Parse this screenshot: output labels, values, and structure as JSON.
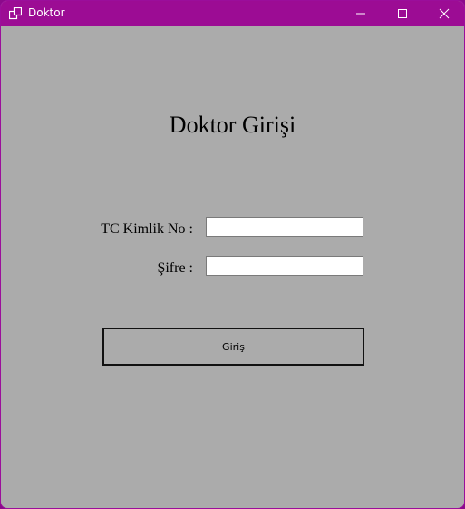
{
  "window": {
    "title": "Doktor",
    "app_icon": "window-icon",
    "controls": [
      "minimize-icon",
      "maximize-icon",
      "close-icon"
    ],
    "accent_color": "#9c0c94",
    "background_color": "#ababab"
  },
  "form": {
    "heading": "Doktor Girişi",
    "tc_label": "TC Kimlik No :",
    "tc_value": "",
    "password_label": "Şifre :",
    "password_value": "",
    "submit_label": "Giriş"
  }
}
